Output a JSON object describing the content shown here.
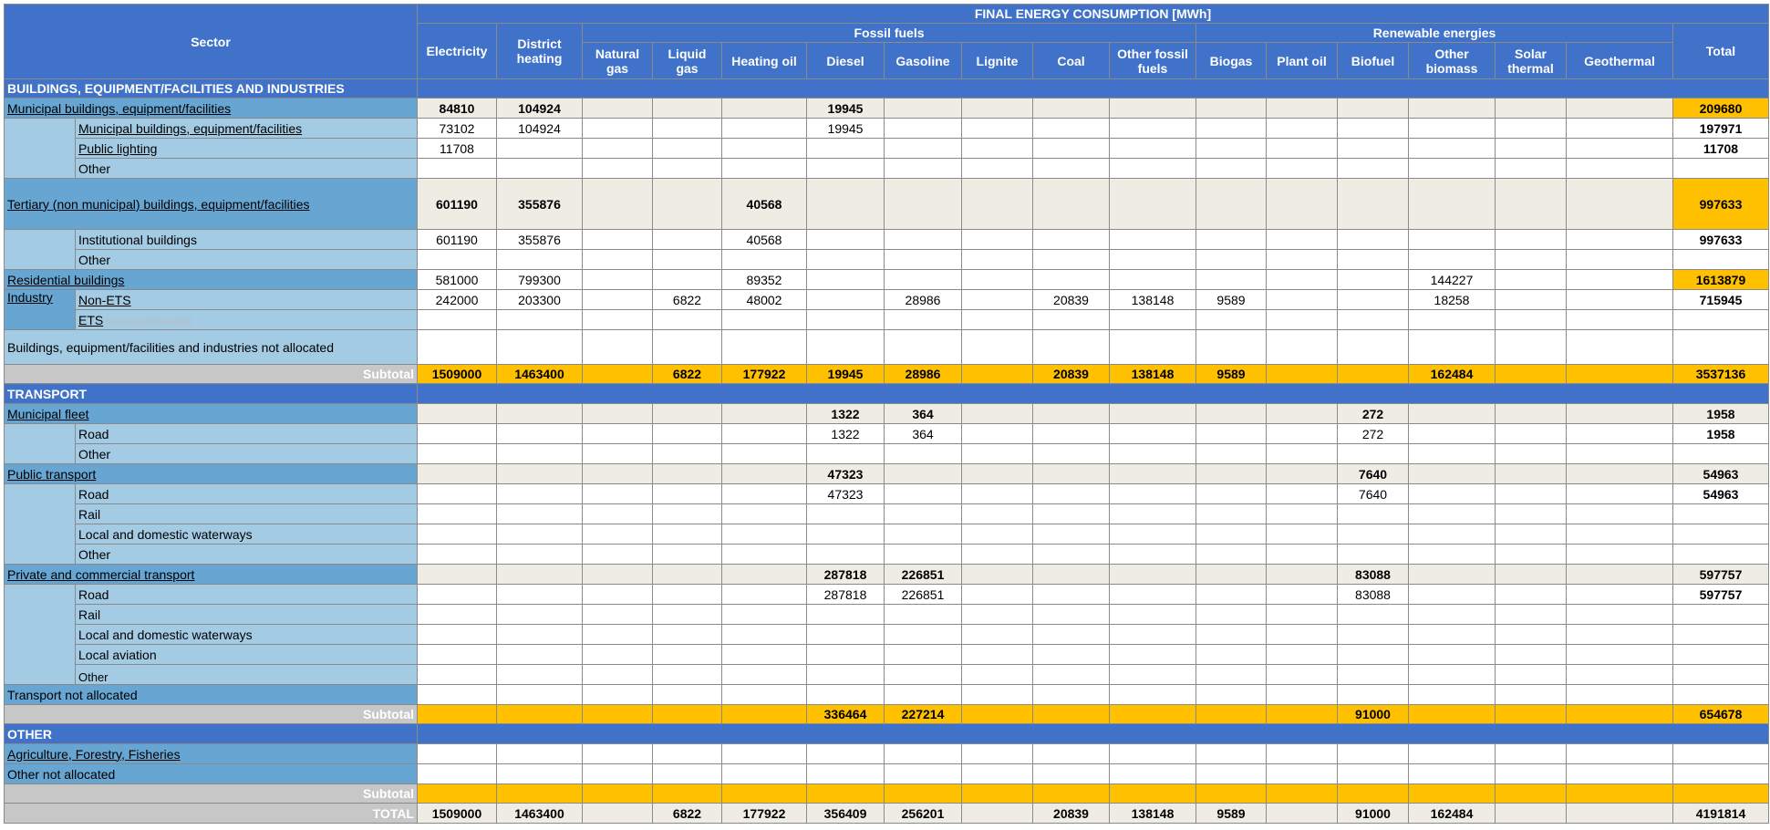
{
  "header": {
    "sector": "Sector",
    "title": "FINAL ENERGY CONSUMPTION [MWh]",
    "electricity": "Electricity",
    "district_heating": "District heating",
    "fossil_fuels": "Fossil fuels",
    "renewable": "Renewable energies",
    "total": "Total",
    "cols": [
      "Natural gas",
      "Liquid gas",
      "Heating oil",
      "Diesel",
      "Gasoline",
      "Lignite",
      "Coal",
      "Other fossil fuels",
      "Biogas",
      "Plant oil",
      "Biofuel",
      "Other biomass",
      "Solar thermal",
      "Geothermal"
    ]
  },
  "sections": {
    "buildings": "BUILDINGS, EQUIPMENT/FACILITIES AND INDUSTRIES",
    "transport": "TRANSPORT",
    "other": "OTHER"
  },
  "labels": {
    "mun_bld": "Municipal buildings, equipment/facilities",
    "mun_bld_sub": "Municipal buildings, equipment/facilities",
    "public_lighting": "Public lighting",
    "other": "Other",
    "tertiary": "Tertiary (non municipal) buildings, equipment/facilities",
    "institutional": "Institutional buildings",
    "residential": "Residential buildings",
    "industry": "Industry",
    "non_ets": "Non-ETS",
    "ets": "ETS",
    "ets_note": "(not recommended)",
    "bld_not_alloc": "Buildings, equipment/facilities and industries not allocated",
    "subtotal": "Subtotal",
    "municipal_fleet": "Municipal fleet",
    "road": "Road",
    "rail": "Rail",
    "waterways": "Local and domestic waterways",
    "public_transport": "Public transport",
    "private_transport": "Private and commercial transport",
    "local_aviation": "Local aviation",
    "transport_not_alloc": "Transport not allocated",
    "agriculture": "Agriculture, Forestry, Fisheries",
    "other_not_alloc": "Other not allocated",
    "total": "TOTAL"
  },
  "values": {
    "mun_bld": {
      "electricity": "84810",
      "district": "104924",
      "diesel": "19945",
      "total": "209680"
    },
    "mun_bld_sub": {
      "electricity": "73102",
      "district": "104924",
      "diesel": "19945",
      "total": "197971"
    },
    "public_lighting": {
      "electricity": "11708",
      "total": "11708"
    },
    "tertiary": {
      "electricity": "601190",
      "district": "355876",
      "heating_oil": "40568",
      "total": "997633"
    },
    "institutional": {
      "electricity": "601190",
      "district": "355876",
      "heating_oil": "40568",
      "total": "997633"
    },
    "residential": {
      "electricity": "581000",
      "district": "799300",
      "heating_oil": "89352",
      "other_biomass": "144227",
      "total": "1613879"
    },
    "non_ets": {
      "electricity": "242000",
      "district": "203300",
      "liquid_gas": "6822",
      "heating_oil": "48002",
      "gasoline": "28986",
      "coal": "20839",
      "other_fossil": "138148",
      "biogas": "9589",
      "other_biomass": "18258",
      "total": "715945"
    },
    "subtotal_bld": {
      "electricity": "1509000",
      "district": "1463400",
      "liquid_gas": "6822",
      "heating_oil": "177922",
      "diesel": "19945",
      "gasoline": "28986",
      "coal": "20839",
      "other_fossil": "138148",
      "biogas": "9589",
      "other_biomass": "162484",
      "total": "3537136"
    },
    "municipal_fleet": {
      "diesel": "1322",
      "gasoline": "364",
      "biofuel": "272",
      "total": "1958"
    },
    "mf_road": {
      "diesel": "1322",
      "gasoline": "364",
      "biofuel": "272",
      "total": "1958"
    },
    "public_transport": {
      "diesel": "47323",
      "biofuel": "7640",
      "total": "54963"
    },
    "pt_road": {
      "diesel": "47323",
      "biofuel": "7640",
      "total": "54963"
    },
    "private_transport": {
      "diesel": "287818",
      "gasoline": "226851",
      "biofuel": "83088",
      "total": "597757"
    },
    "prt_road": {
      "diesel": "287818",
      "gasoline": "226851",
      "biofuel": "83088",
      "total": "597757"
    },
    "subtotal_tr": {
      "diesel": "336464",
      "gasoline": "227214",
      "biofuel": "91000",
      "total": "654678"
    },
    "grand_total": {
      "electricity": "1509000",
      "district": "1463400",
      "liquid_gas": "6822",
      "heating_oil": "177922",
      "diesel": "356409",
      "gasoline": "256201",
      "coal": "20839",
      "other_fossil": "138148",
      "biogas": "9589",
      "biofuel": "91000",
      "other_biomass": "162484",
      "total": "4191814"
    }
  }
}
